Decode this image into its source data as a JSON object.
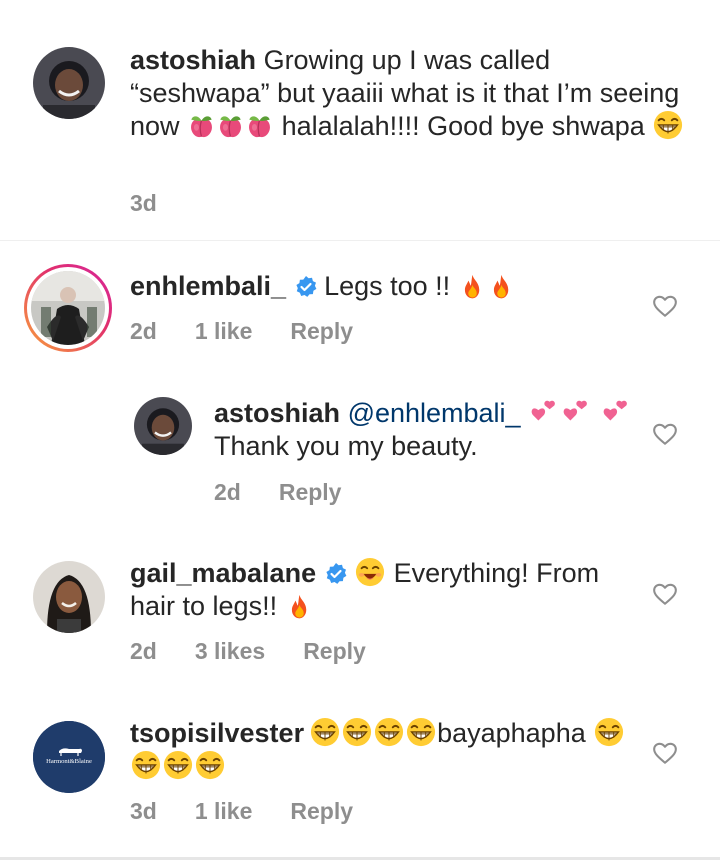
{
  "comments": [
    {
      "username": "astoshiah",
      "text_1": "Growing up I was called “seshwapa” but yaaiii what is it that I’m seeing now",
      "text_2": "halalalah!!!! Good bye shwapa",
      "time": "3d"
    },
    {
      "username": "enhlembali_",
      "text": "Legs too !!",
      "time": "2d",
      "likes": "1 like",
      "reply_label": "Reply"
    },
    {
      "username": "astoshiah",
      "mention": "@enhlembali_",
      "text": "Thank you my beauty.",
      "time": "2d",
      "reply_label": "Reply"
    },
    {
      "username": "gail_mabalane",
      "text_1": "Everything! From hair to legs!!",
      "time": "2d",
      "likes": "3 likes",
      "reply_label": "Reply"
    },
    {
      "username": "tsopisilvester",
      "text": "bayaphapha",
      "avatar_logo_text": "Harmont&Blaine",
      "time": "3d",
      "likes": "1 like",
      "reply_label": "Reply"
    }
  ],
  "icons": {
    "like": "heart-outline-icon",
    "verified": "verified-badge-icon",
    "emoji_grin": "grinning-squinting-face",
    "emoji_peach": "peach",
    "emoji_fire": "fire",
    "emoji_hearts": "two-hearts",
    "emoji_smile": "smiling-face-closed-eyes"
  },
  "colors": {
    "text": "#262626",
    "meta": "#8e8e8e",
    "mention": "#00376b",
    "verified": "#3897f0",
    "story_ring_start": "#f9a23a",
    "story_ring_end": "#d6249f",
    "avatar_bg_tsopi": "#1f3c6b"
  }
}
